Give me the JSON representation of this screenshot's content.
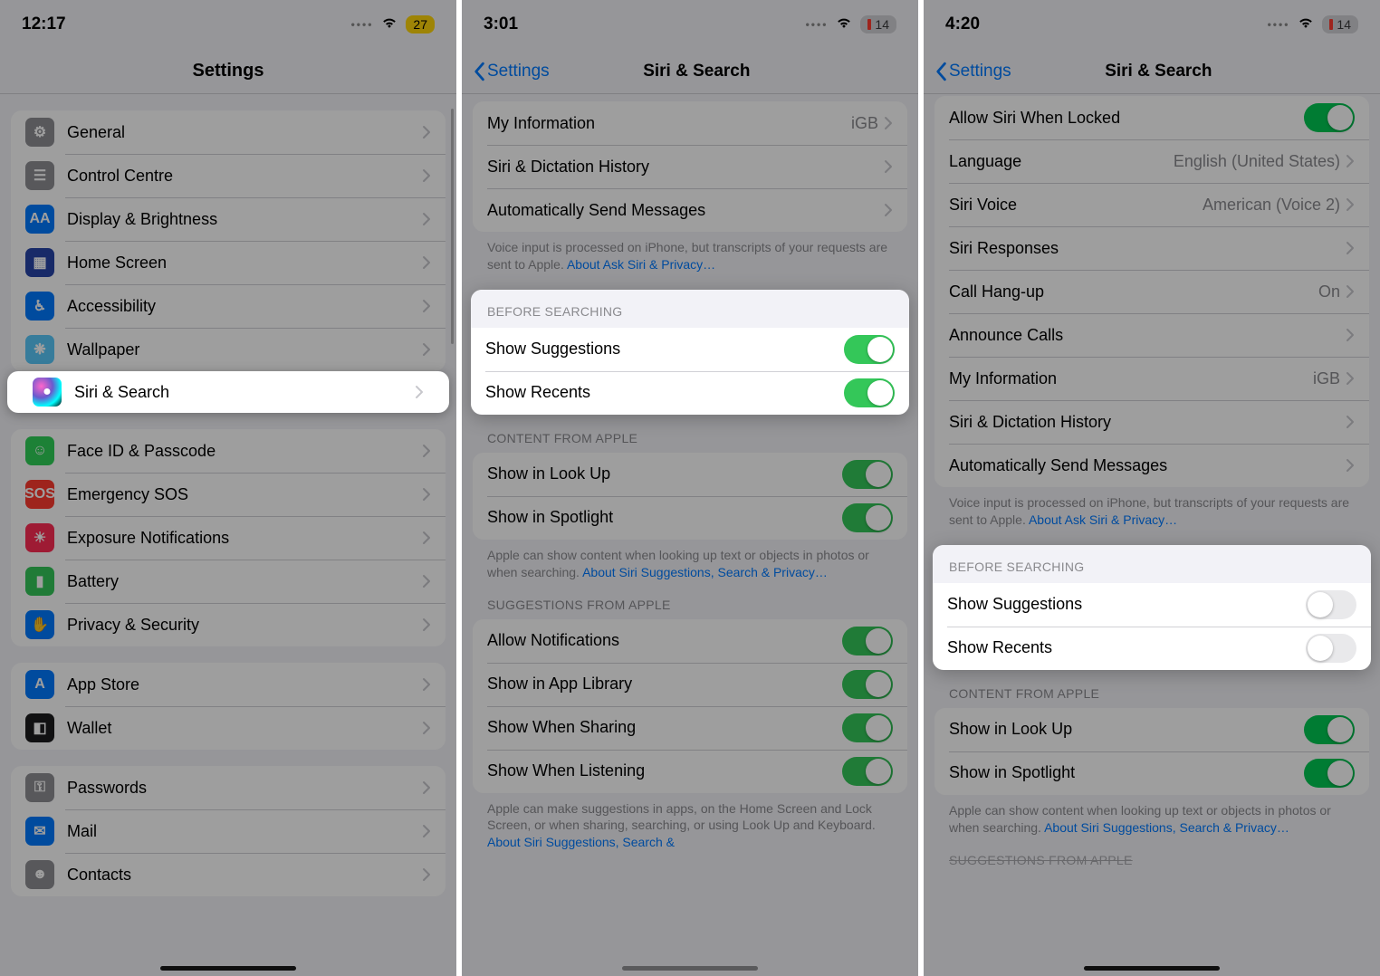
{
  "panel1": {
    "status": {
      "time": "12:17",
      "battery": "27"
    },
    "title": "Settings",
    "groups": [
      {
        "rows": [
          {
            "label": "General",
            "icon": "gear",
            "bg": "bg-grey"
          },
          {
            "label": "Control Centre",
            "icon": "sliders",
            "bg": "bg-grey"
          },
          {
            "label": "Display & Brightness",
            "icon": "AA",
            "bg": "bg-blue"
          },
          {
            "label": "Home Screen",
            "icon": "grid",
            "bg": "bg-darkblue"
          },
          {
            "label": "Accessibility",
            "icon": "person",
            "bg": "bg-blue"
          },
          {
            "label": "Wallpaper",
            "icon": "flower",
            "bg": "bg-teal"
          },
          {
            "label": "Siri & Search",
            "icon": "siri",
            "bg": "siri-orb",
            "highlight": true
          },
          {
            "label": "Face ID & Passcode",
            "icon": "face",
            "bg": "bg-faceid"
          },
          {
            "label": "Emergency SOS",
            "icon": "SOS",
            "bg": "bg-red"
          },
          {
            "label": "Exposure Notifications",
            "icon": "virus",
            "bg": "bg-expo"
          },
          {
            "label": "Battery",
            "icon": "battery",
            "bg": "bg-green"
          },
          {
            "label": "Privacy & Security",
            "icon": "hand",
            "bg": "bg-blue"
          }
        ]
      },
      {
        "rows": [
          {
            "label": "App Store",
            "icon": "A",
            "bg": "bg-blue"
          },
          {
            "label": "Wallet",
            "icon": "wallet",
            "bg": "bg-black"
          }
        ]
      },
      {
        "rows": [
          {
            "label": "Passwords",
            "icon": "key",
            "bg": "bg-grey"
          },
          {
            "label": "Mail",
            "icon": "mail",
            "bg": "bg-blue"
          },
          {
            "label": "Contacts",
            "icon": "contact",
            "bg": "bg-grey"
          }
        ]
      }
    ]
  },
  "panel2": {
    "status": {
      "time": "3:01",
      "battery": "14"
    },
    "back": "Settings",
    "title": "Siri & Search",
    "topRows": [
      {
        "label": "My Information",
        "value": "iGB"
      },
      {
        "label": "Siri & Dictation History"
      },
      {
        "label": "Automatically Send Messages"
      }
    ],
    "topFooter": "Voice input is processed on iPhone, but transcripts of your requests are sent to Apple.",
    "topFooterLink": "About Ask Siri & Privacy…",
    "beforeHeader": "BEFORE SEARCHING",
    "beforeRows": [
      {
        "label": "Show Suggestions",
        "on": true
      },
      {
        "label": "Show Recents",
        "on": true
      }
    ],
    "contentHeader": "CONTENT FROM APPLE",
    "contentRows": [
      {
        "label": "Show in Look Up",
        "on": true
      },
      {
        "label": "Show in Spotlight",
        "on": true
      }
    ],
    "contentFooter": "Apple can show content when looking up text or objects in photos or when searching.",
    "contentFooterLink": "About Siri Suggestions, Search & Privacy…",
    "suggHeader": "SUGGESTIONS FROM APPLE",
    "suggRows": [
      {
        "label": "Allow Notifications",
        "on": true
      },
      {
        "label": "Show in App Library",
        "on": true
      },
      {
        "label": "Show When Sharing",
        "on": true
      },
      {
        "label": "Show When Listening",
        "on": true
      }
    ],
    "suggFooter": "Apple can make suggestions in apps, on the Home Screen and Lock Screen, or when sharing, searching, or using Look Up and Keyboard.",
    "suggFooterLink": "About Siri Suggestions, Search &"
  },
  "panel3": {
    "status": {
      "time": "4:20",
      "battery": "14"
    },
    "back": "Settings",
    "title": "Siri & Search",
    "topRows": [
      {
        "label": "Allow Siri When Locked",
        "toggle": true,
        "on": true
      },
      {
        "label": "Language",
        "value": "English (United States)"
      },
      {
        "label": "Siri Voice",
        "value": "American (Voice 2)"
      },
      {
        "label": "Siri Responses"
      },
      {
        "label": "Call Hang-up",
        "value": "On"
      },
      {
        "label": "Announce Calls"
      },
      {
        "label": "My Information",
        "value": "iGB"
      },
      {
        "label": "Siri & Dictation History"
      },
      {
        "label": "Automatically Send Messages"
      }
    ],
    "topFooter": "Voice input is processed on iPhone, but transcripts of your requests are sent to Apple.",
    "topFooterLink": "About Ask Siri & Privacy…",
    "beforeHeader": "BEFORE SEARCHING",
    "beforeRows": [
      {
        "label": "Show Suggestions",
        "on": false
      },
      {
        "label": "Show Recents",
        "on": false
      }
    ],
    "contentHeader": "CONTENT FROM APPLE",
    "contentRows": [
      {
        "label": "Show in Look Up",
        "on": true
      },
      {
        "label": "Show in Spotlight",
        "on": true
      }
    ],
    "contentFooter": "Apple can show content when looking up text or objects in photos or when searching.",
    "contentFooterLink": "About Siri Suggestions, Search & Privacy…",
    "suggHeader": "SUGGESTIONS FROM APPLE"
  },
  "icons": {
    "chevron": "›"
  }
}
